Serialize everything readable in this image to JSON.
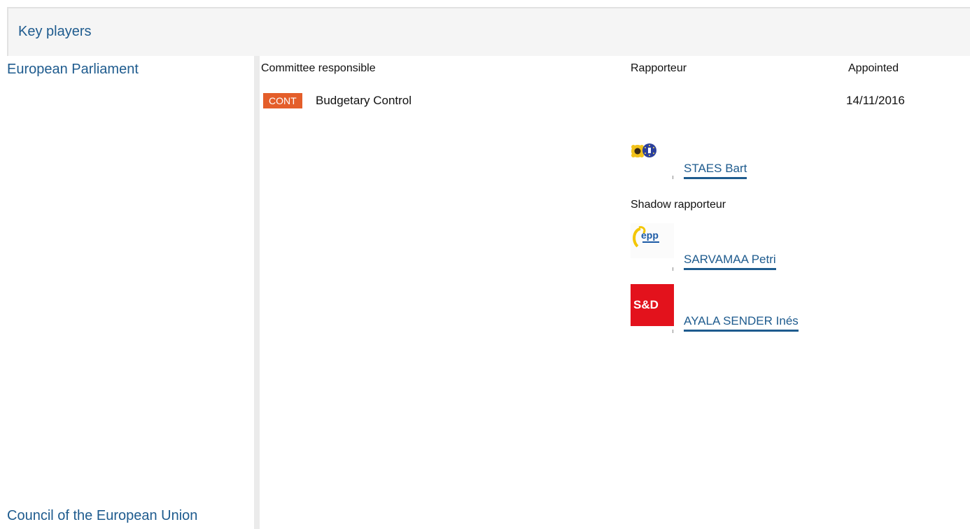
{
  "header": {
    "title": "Key players"
  },
  "institutions": {
    "ep": "European Parliament",
    "council": "Council of the European Union"
  },
  "table": {
    "col_committee": "Committee responsible",
    "col_rapporteur": "Rapporteur",
    "col_appointed": "Appointed"
  },
  "committee": {
    "badge": "CONT",
    "name": "Budgetary Control",
    "appointed": "14/11/2016"
  },
  "rapporteur": {
    "name": "STAES Bart",
    "group_logo": "greens-efa-logo"
  },
  "shadow": {
    "label": "Shadow rapporteur",
    "people": [
      {
        "name": "SARVAMAA Petri",
        "group_logo": "epp-logo"
      },
      {
        "name": "AYALA SENDER Inés",
        "group_logo": "s-and-d-logo",
        "logo_text": "S&D"
      }
    ]
  },
  "colors": {
    "link": "#1e5b8e",
    "badge": "#e45e2a",
    "s_and_d": "#e3121c"
  }
}
